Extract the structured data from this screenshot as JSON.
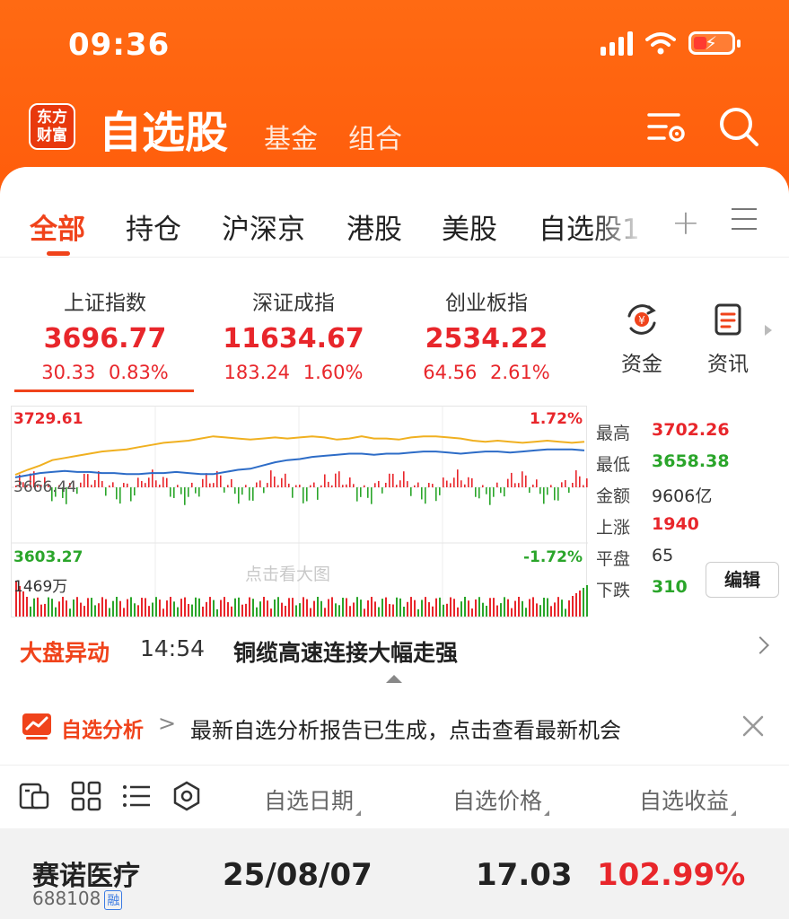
{
  "status": {
    "time": "09:36"
  },
  "header": {
    "logo": [
      "东方",
      "财富"
    ],
    "title": "自选股",
    "tabs": [
      "基金",
      "组合"
    ]
  },
  "tabs": {
    "items": [
      "全部",
      "持仓",
      "沪深京",
      "港股",
      "美股",
      "自选股1"
    ],
    "active": "全部",
    "plus": "+"
  },
  "indices": [
    {
      "name": "上证指数",
      "value": "3696.77",
      "change": "30.33",
      "pct": "0.83%"
    },
    {
      "name": "深证成指",
      "value": "11634.67",
      "change": "183.24",
      "pct": "1.60%"
    },
    {
      "name": "创业板指",
      "value": "2534.22",
      "change": "64.56",
      "pct": "2.61%"
    }
  ],
  "quick": [
    {
      "label": "资金",
      "icon": "fund-flow-icon"
    },
    {
      "label": "资讯",
      "icon": "news-doc-icon"
    }
  ],
  "chart": {
    "top_label": "3729.61",
    "top_pct": "1.72%",
    "mid_label": "3666.44",
    "bottom_label": "3603.27",
    "bottom_pct": "-1.72%",
    "vol_label": "1469万",
    "hint": "点击看大图",
    "colors": {
      "index_line": "#f0b020",
      "avg_line": "#2d6cc7",
      "up": "#e8262b",
      "down": "#2aa52a"
    }
  },
  "chart_data": {
    "type": "line",
    "title": "",
    "ylim": [
      3603.27,
      3729.61
    ],
    "series": [
      {
        "values": [
          3666.44,
          3671,
          3675,
          3680,
          3682,
          3684,
          3686,
          3688,
          3689,
          3690,
          3692,
          3694,
          3696,
          3697,
          3698,
          3700,
          3702,
          3701,
          3700,
          3699,
          3700,
          3701,
          3700,
          3701,
          3702,
          3701,
          3699,
          3700,
          3702,
          3700,
          3700,
          3699,
          3701,
          3702,
          3702,
          3701,
          3700,
          3698,
          3697,
          3698,
          3697,
          3696,
          3697,
          3698,
          3697,
          3696,
          3697
        ]
      },
      {
        "values": [
          3664,
          3666,
          3668,
          3669,
          3670,
          3669,
          3669,
          3668,
          3668,
          3667,
          3667,
          3668,
          3668,
          3669,
          3668,
          3667,
          3667,
          3669,
          3671,
          3672,
          3675,
          3678,
          3680,
          3681,
          3683,
          3684,
          3685,
          3686,
          3686,
          3685,
          3686,
          3686,
          3687,
          3688,
          3688,
          3687,
          3686,
          3687,
          3688,
          3688,
          3687,
          3688,
          3689,
          3690,
          3690,
          3690,
          3689
        ]
      }
    ]
  },
  "stats": [
    {
      "k": "最高",
      "v": "3702.26",
      "c": "#e8262b"
    },
    {
      "k": "最低",
      "v": "3658.38",
      "c": "#2aa52a"
    },
    {
      "k": "金额",
      "v": "9606亿",
      "c": "#333333"
    },
    {
      "k": "上涨",
      "v": "1940",
      "c": "#e8262b"
    },
    {
      "k": "平盘",
      "v": "65",
      "c": "#333333"
    },
    {
      "k": "下跌",
      "v": "310",
      "c": "#2aa52a"
    }
  ],
  "edit_label": "编辑",
  "news": {
    "tag": "大盘异动",
    "time": "14:54",
    "text": "铜缆高速连接大幅走强"
  },
  "analysis": {
    "tag": "自选分析",
    "gt": ">",
    "text": "最新自选分析报告已生成，点击查看最新机会"
  },
  "columns": [
    "自选日期",
    "自选价格",
    "自选收益"
  ],
  "stock": {
    "name": "赛诺医疗",
    "code": "688108",
    "badge": "融",
    "date": "25/08/07",
    "price": "17.03",
    "gain": "102.99%"
  }
}
